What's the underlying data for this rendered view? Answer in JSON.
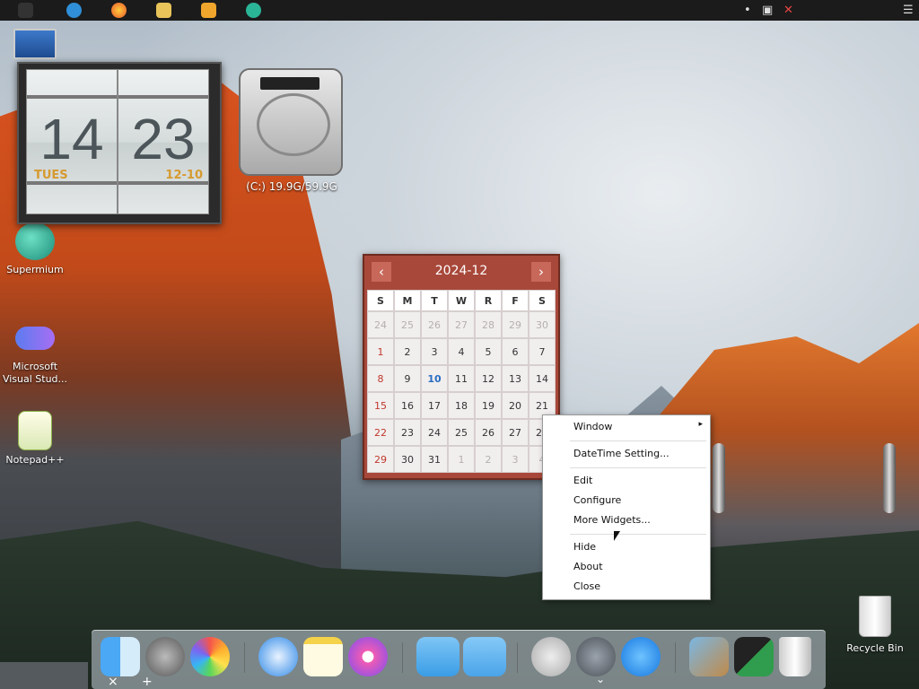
{
  "topbar": {
    "apps": [
      "apple-icon",
      "internet-explorer-icon",
      "firefox-icon",
      "file-explorer-icon",
      "media-player-icon",
      "supermium-icon"
    ],
    "tray": [
      "dot-icon",
      "network-icon",
      "volume-muted-icon",
      "menu-icon"
    ]
  },
  "desktop": {
    "icons": [
      {
        "label": "Supermium"
      },
      {
        "label": "Microsoft Visual Stud..."
      },
      {
        "label": "Notepad++"
      }
    ],
    "recycle_bin": "Recycle Bin"
  },
  "clock": {
    "hour": "14",
    "minute": "23",
    "day": "TUES",
    "date": "12-10"
  },
  "hdd": {
    "text": "(C:) 19.9G/59.9G"
  },
  "calendar": {
    "title": "2024-12",
    "weekdays": [
      "S",
      "M",
      "T",
      "W",
      "R",
      "F",
      "S"
    ],
    "weeks": [
      [
        "24",
        "25",
        "26",
        "27",
        "28",
        "29",
        "30"
      ],
      [
        "1",
        "2",
        "3",
        "4",
        "5",
        "6",
        "7"
      ],
      [
        "8",
        "9",
        "10",
        "11",
        "12",
        "13",
        "14"
      ],
      [
        "15",
        "16",
        "17",
        "18",
        "19",
        "20",
        "21"
      ],
      [
        "22",
        "23",
        "24",
        "25",
        "26",
        "27",
        "28"
      ],
      [
        "29",
        "30",
        "31",
        "1",
        "2",
        "3",
        "4"
      ]
    ],
    "today": "10"
  },
  "context_menu": {
    "window": "Window",
    "datetime": "DateTime Setting...",
    "edit": "Edit",
    "configure": "Configure",
    "more_widgets": "More Widgets...",
    "hide": "Hide",
    "about": "About",
    "close": "Close"
  },
  "dock": {
    "items": [
      "finder-icon",
      "system-preferences-icon",
      "photos-icon",
      "safari-icon",
      "notes-icon",
      "itunes-icon",
      "folder-icon",
      "applications-folder-icon",
      "power-icon",
      "launchpad-icon",
      "app-store-icon",
      "preview-icon",
      "widgets-icon",
      "trash-icon"
    ],
    "close": "×",
    "add": "+"
  }
}
